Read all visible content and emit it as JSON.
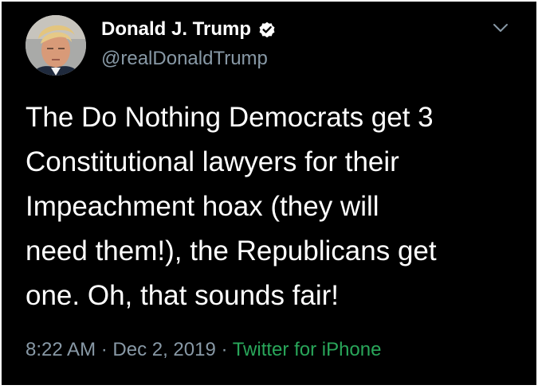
{
  "tweet": {
    "display_name": "Donald J. Trump",
    "handle": "@realDonaldTrump",
    "verified": true,
    "text_lines": [
      "The Do Nothing Democrats get 3",
      "Constitutional lawyers for their",
      "Impeachment hoax (they will",
      "need them!), the Republicans get",
      "one. Oh, that sounds fair!"
    ],
    "time": "8:22 AM",
    "separator_1": " · ",
    "date": "Dec 2, 2019",
    "separator_2": " · ",
    "source": "Twitter for iPhone"
  },
  "icons": {
    "verified": "verified-badge-icon",
    "menu": "chevron-down-icon"
  },
  "colors": {
    "background": "#000000",
    "text": "#ffffff",
    "secondary_text": "#8899a6",
    "source_link": "#29a65a"
  }
}
